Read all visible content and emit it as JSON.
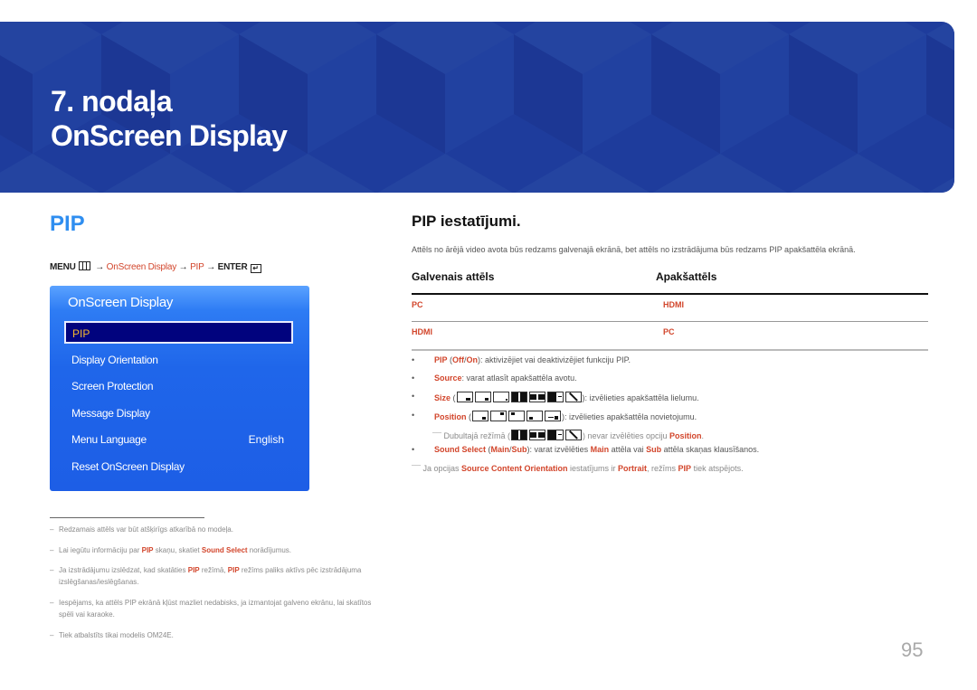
{
  "banner": {
    "chapter_number": "7. nodaļa",
    "chapter_title": "OnScreen Display",
    "color": "#1e3c9c"
  },
  "left": {
    "heading": "PIP",
    "menu_path": {
      "menu": "MENU",
      "arrow": "→",
      "step1": "OnScreen Display",
      "step2": "PIP",
      "enter": "ENTER"
    },
    "osd_menu": {
      "title": "OnScreen Display",
      "selected": "PIP",
      "items": [
        {
          "label": "Display Orientation"
        },
        {
          "label": "Screen Protection"
        },
        {
          "label": "Message Display"
        },
        {
          "label": "Menu Language",
          "value": "English"
        },
        {
          "label": "Reset OnScreen Display"
        }
      ]
    },
    "notes": [
      {
        "text": "Redzamais attēls var būt atšķirīgs atkarībā no modeļa."
      },
      {
        "pre": "Lai iegūtu informāciju par ",
        "b1": "PIP",
        "mid": " skaņu, skatiet ",
        "b2": "Sound Select",
        "post": " norādījumus."
      },
      {
        "pre": "Ja izstrādājumu izslēdzat, kad skatāties ",
        "b1": "PIP",
        "mid": " režīmā, ",
        "b2": "PIP",
        "post": " režīms paliks aktīvs pēc izstrādājuma izslēgšanas/ieslēgšanas."
      },
      {
        "text": "Iespējams, ka attēls PIP ekrānā kļūst mazliet nedabisks, ja izmantojat galveno ekrānu, lai skatītos spēli vai karaoke."
      },
      {
        "text": "Tiek atbalstīts tikai modelis OM24E."
      }
    ]
  },
  "right": {
    "title": "PIP iestatījumi.",
    "description": "Attēls no ārējā video avota būs redzams galvenajā ekrānā, bet attēls no izstrādājuma būs redzams PIP apakšattēla ekrānā.",
    "table": {
      "headers": [
        "Galvenais attēls",
        "Apakšattēls"
      ],
      "rows": [
        [
          "PC",
          "HDMI"
        ],
        [
          "HDMI",
          "PC"
        ]
      ]
    },
    "bullets": {
      "pip": {
        "label": "PIP",
        "open": " (",
        "off": "Off",
        "slash": "/",
        "on": "On",
        "close": ")",
        "text": ": aktivizējiet vai deaktivizējiet funkciju PIP."
      },
      "source": {
        "label": "Source",
        "text": ": varat atlasīt apakšattēla avotu."
      },
      "size": {
        "label": "Size",
        "text": "): izvēlieties apakšattēla lielumu.",
        "icons": [
          "pip-small-icon",
          "pip-medium-icon",
          "pip-large-icon",
          "split-equal-icon",
          "split-wide-icon",
          "split-main-sub-icon",
          "split-diagonal-icon"
        ]
      },
      "position": {
        "label": "Position",
        "text": "): izvēlieties apakšattēla novietojumu.",
        "icons": [
          "pos-bottom-right-icon",
          "pos-top-right-icon",
          "pos-top-left-icon",
          "pos-bottom-left-icon",
          "pos-custom-icon"
        ]
      },
      "dual_note": {
        "pre": "Dubultajā režīmā (",
        "post": ") nevar izvēlēties opciju ",
        "bold": "Position",
        "end": "."
      },
      "sound": {
        "label": "Sound Select",
        "open": " (",
        "main": "Main",
        "slash": "/",
        "sub": "Sub",
        "close": ")",
        "t1": ": varat izvēlēties ",
        "b1": "Main",
        "t2": " attēla vai ",
        "b2": "Sub",
        "t3": " attēla skaņas klausīšanos."
      }
    },
    "footnote": {
      "pre": "Ja opcijas ",
      "b1": "Source Content Orientation",
      "mid": " iestatījums ir ",
      "b2": "Portrait",
      "mid2": ", režīms ",
      "b3": "PIP",
      "post": " tiek atspējots."
    }
  },
  "page_number": "95",
  "colors": {
    "accent_red": "#d2452b",
    "heading_blue": "#2f8ef0",
    "osd_selected_bg": "#01037e",
    "osd_selected_text": "#f5b82e"
  }
}
